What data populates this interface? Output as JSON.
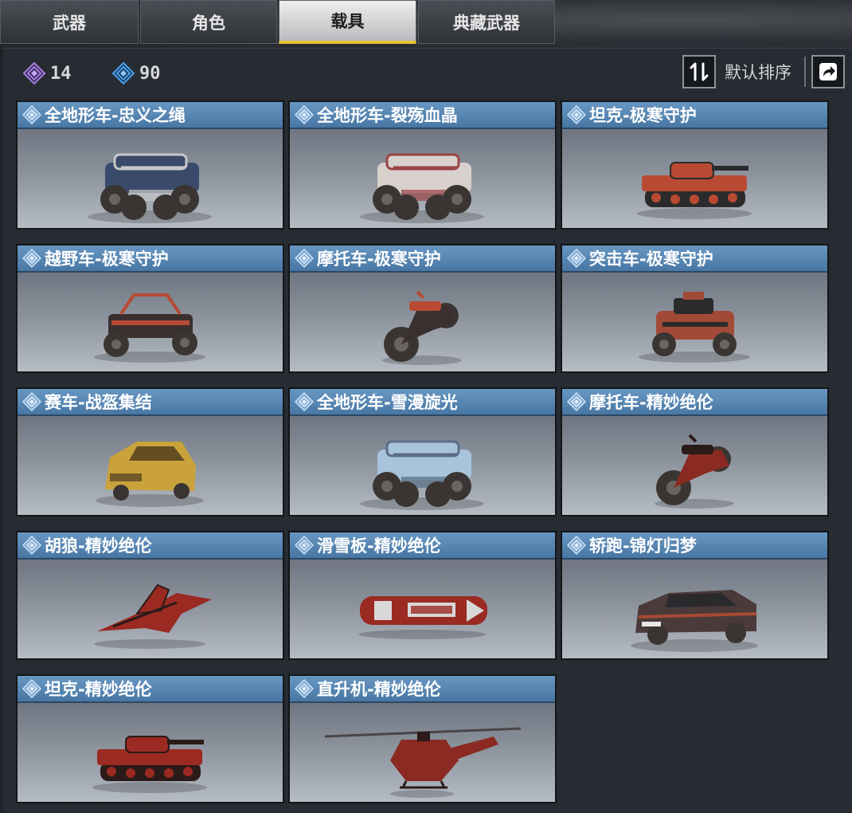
{
  "tabs": [
    {
      "label": "武器",
      "active": false
    },
    {
      "label": "角色",
      "active": false
    },
    {
      "label": "载具",
      "active": true
    },
    {
      "label": "典藏武器",
      "active": false
    }
  ],
  "toolbar": {
    "currency_purple": {
      "icon": "purple-diamond-icon",
      "value": "14",
      "color": "#a67de0"
    },
    "currency_blue": {
      "icon": "blue-diamond-icon",
      "value": "90",
      "color": "#4a9fe6"
    },
    "sort_icon": "sort-arrows-icon",
    "sort_label": "默认排序",
    "share_icon": "share-icon"
  },
  "colors": {
    "header_blue": "#5886b3",
    "active_tab_underline": "#e6c43a",
    "background": "#272b32"
  },
  "items": [
    {
      "name": "全地形车-忠义之绳",
      "vehicle": "atv",
      "body": "#3a4a6a",
      "accent": "#c8c8c8"
    },
    {
      "name": "全地形车-裂殇血晶",
      "vehicle": "atv",
      "body": "#d8d0cc",
      "accent": "#9a4444"
    },
    {
      "name": "坦克-极寒守护",
      "vehicle": "tank",
      "body": "#b84a33",
      "accent": "#2b2b2b"
    },
    {
      "name": "越野车-极寒守护",
      "vehicle": "buggy",
      "body": "#3a3030",
      "accent": "#b84a33"
    },
    {
      "name": "摩托车-极寒守护",
      "vehicle": "motorbike",
      "body": "#3a3030",
      "accent": "#b84a33"
    },
    {
      "name": "突击车-极寒守护",
      "vehicle": "assault",
      "body": "#a24a38",
      "accent": "#2b2b2b"
    },
    {
      "name": "赛车-战盔集结",
      "vehicle": "racecar",
      "body": "#c9a23a",
      "accent": "#3a2a1a"
    },
    {
      "name": "全地形车-雪漫旋光",
      "vehicle": "atv",
      "body": "#a8c4dc",
      "accent": "#5a6e86"
    },
    {
      "name": "摩托车-精妙绝伦",
      "vehicle": "motorbike",
      "body": "#8a2a22",
      "accent": "#2a1a18"
    },
    {
      "name": "胡狼-精妙绝伦",
      "vehicle": "glider",
      "body": "#9a2a22",
      "accent": "#2a1a18"
    },
    {
      "name": "滑雪板-精妙绝伦",
      "vehicle": "snowboard",
      "body": "#9a2a22",
      "accent": "#d8d8d8"
    },
    {
      "name": "轿跑-锦灯归梦",
      "vehicle": "coupe",
      "body": "#4a3a3a",
      "accent": "#a84a33"
    },
    {
      "name": "坦克-精妙绝伦",
      "vehicle": "tank",
      "body": "#9a2a22",
      "accent": "#2a1a18"
    },
    {
      "name": "直升机-精妙绝伦",
      "vehicle": "helicopter",
      "body": "#8a2a22",
      "accent": "#2a1a18"
    }
  ]
}
